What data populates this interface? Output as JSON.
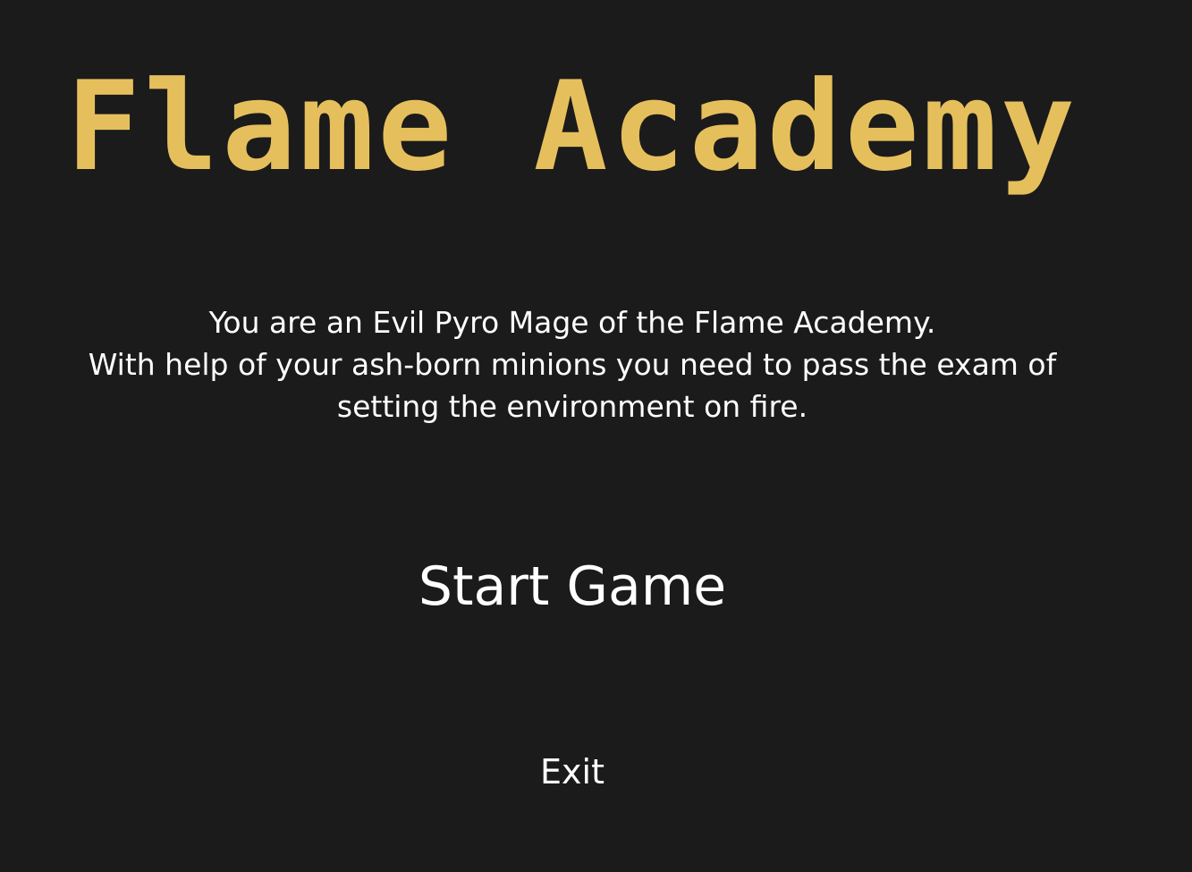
{
  "title": "Flame Academy",
  "intro": {
    "lines": [
      "You are an Evil Pyro Mage of the Flame Academy.",
      "With help of your ash-born minions you need to pass the exam of",
      "setting the environment on fire."
    ]
  },
  "menu": {
    "start_label": "Start Game",
    "exit_label": "Exit"
  },
  "colors": {
    "background": "#1b1b1b",
    "title": "#e6bf5d",
    "text": "#ffffff"
  }
}
